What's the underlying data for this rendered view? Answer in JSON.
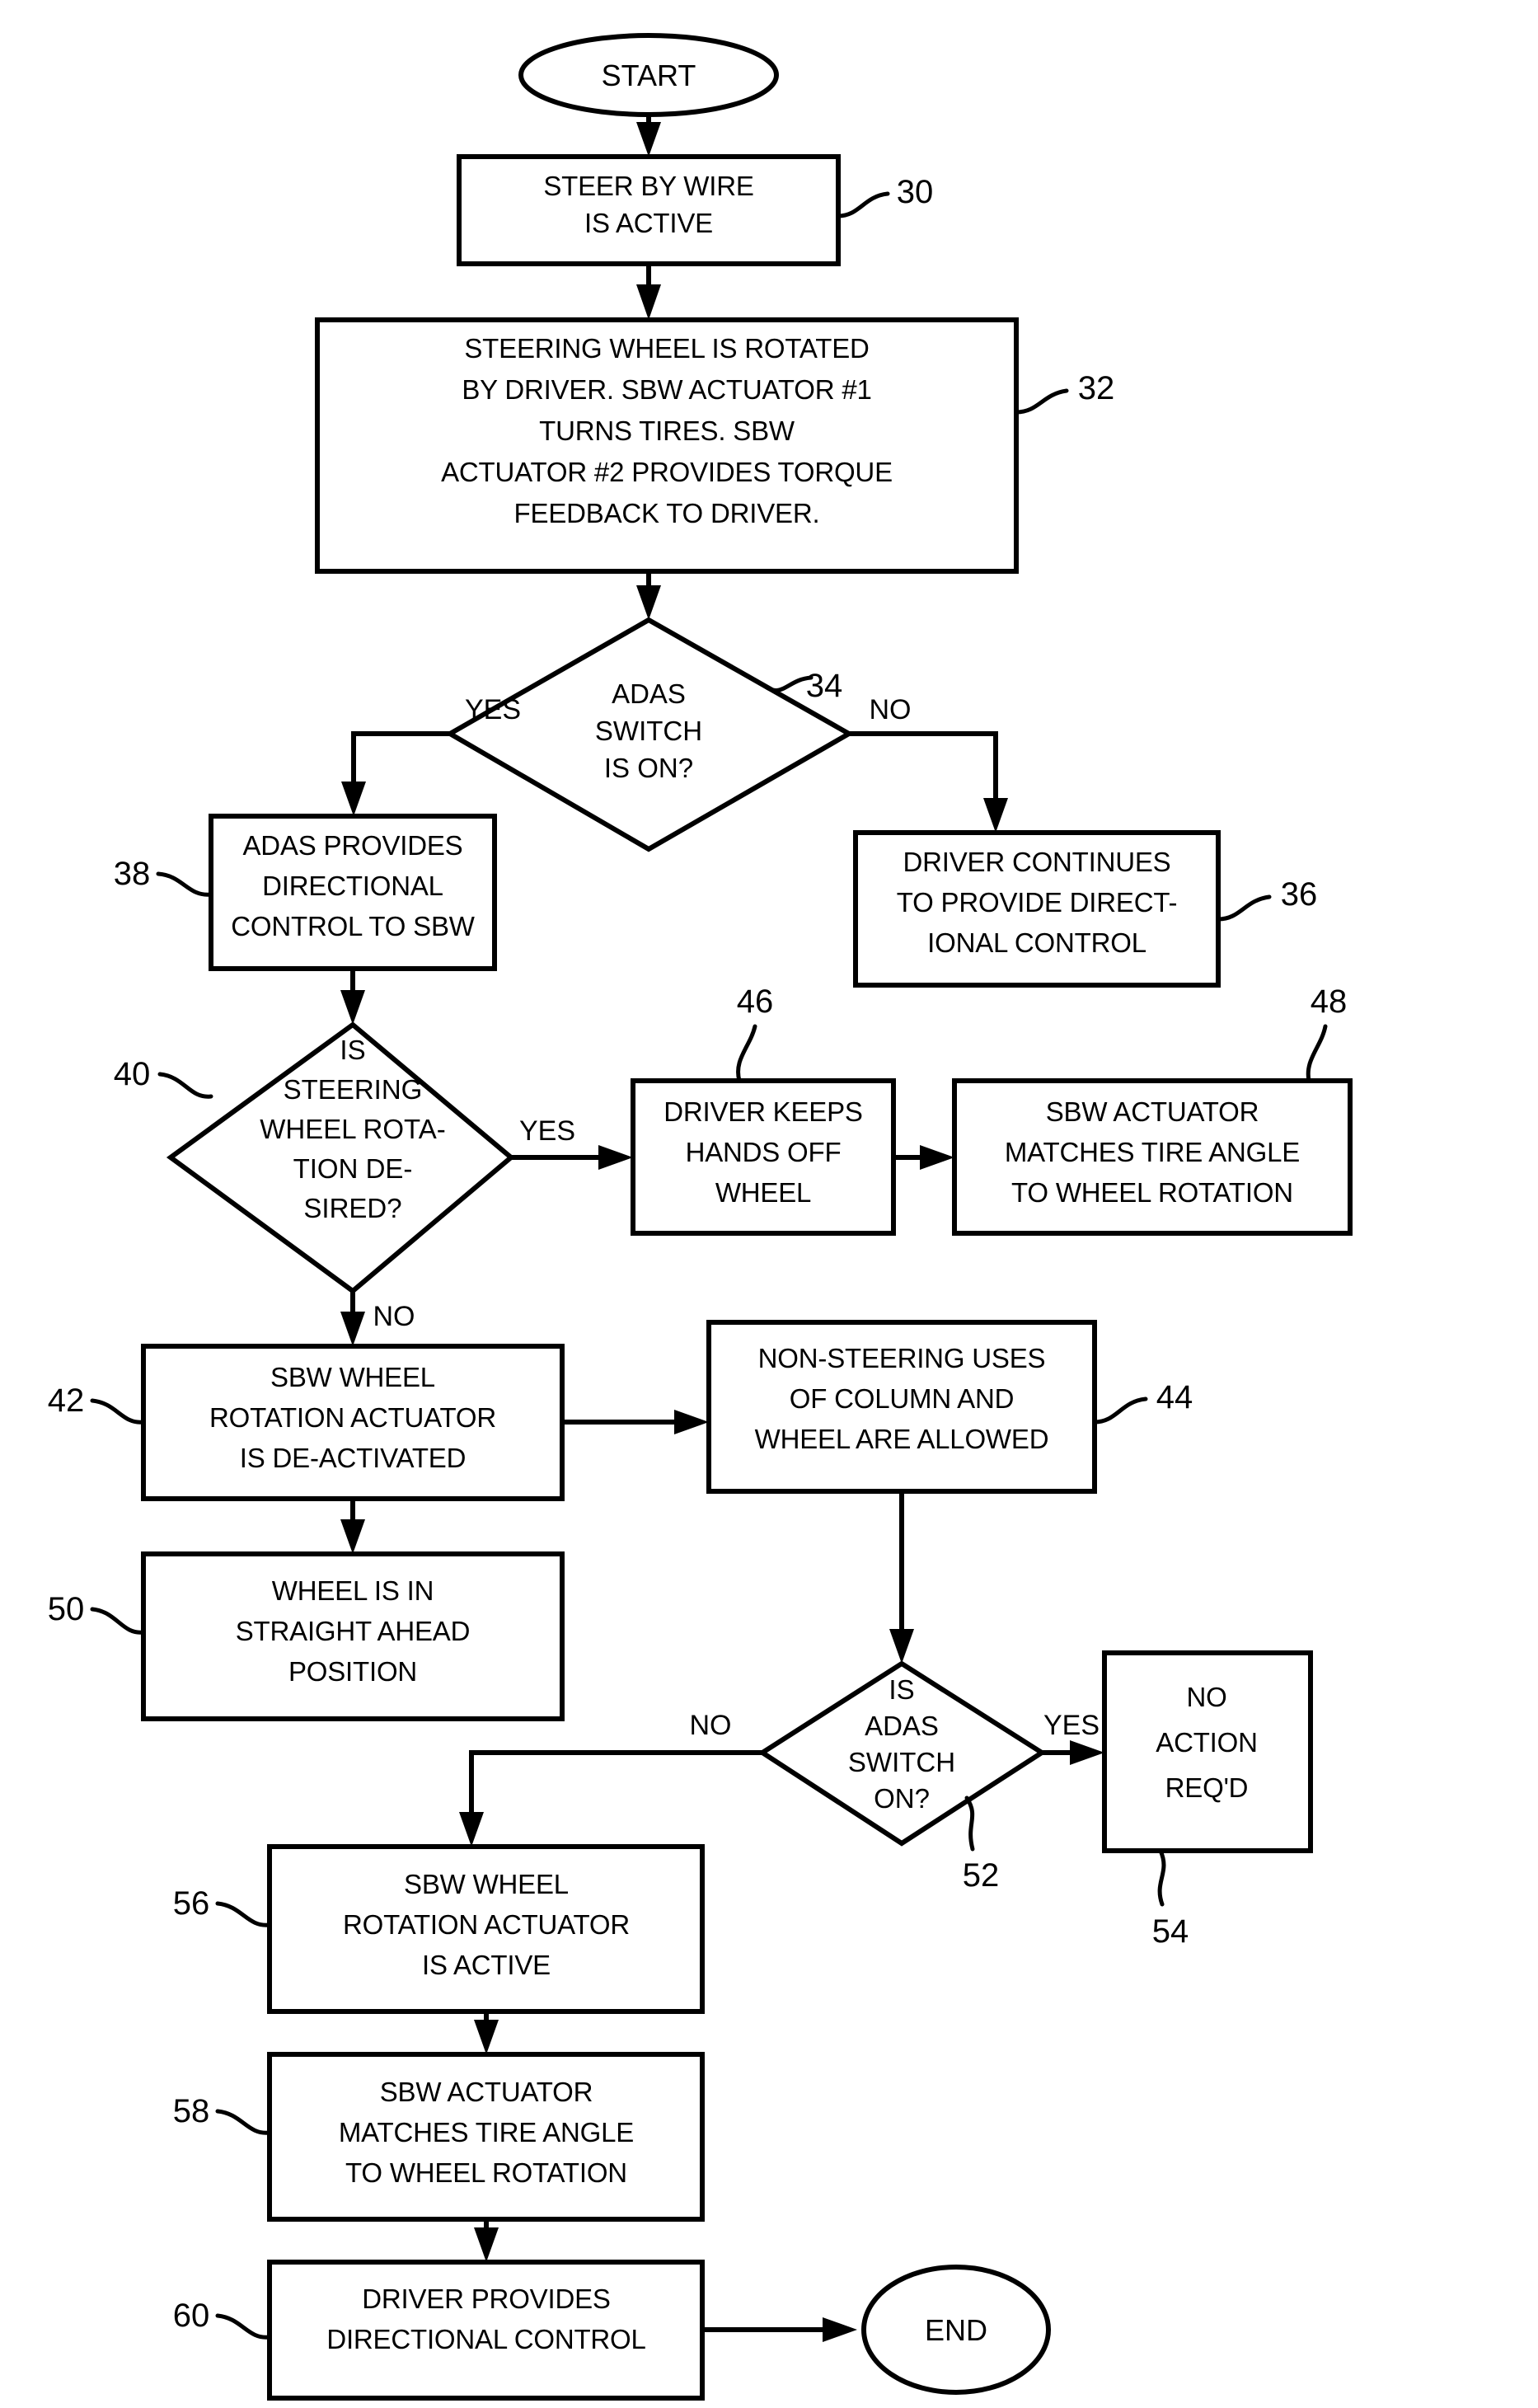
{
  "figure": {
    "type": "patent-flowchart",
    "title": "Steer-by-wire ADAS control flowchart"
  },
  "terminals": {
    "start": "START",
    "end": "END"
  },
  "nodes": [
    {
      "ref": "30",
      "kind": "process",
      "lines": [
        "STEER BY WIRE",
        "IS ACTIVE"
      ]
    },
    {
      "ref": "32",
      "kind": "process",
      "lines": [
        "STEERING WHEEL IS ROTATED",
        "BY DRIVER. SBW ACTUATOR #1",
        "TURNS TIRES. SBW",
        "ACTUATOR #2 PROVIDES TORQUE",
        "FEEDBACK TO DRIVER."
      ]
    },
    {
      "ref": "34",
      "kind": "decision",
      "lines": [
        "ADAS",
        "SWITCH",
        "IS ON?"
      ]
    },
    {
      "ref": "36",
      "kind": "process",
      "lines": [
        "DRIVER CONTINUES",
        "TO PROVIDE DIRECT-",
        "IONAL CONTROL"
      ]
    },
    {
      "ref": "38",
      "kind": "process",
      "lines": [
        "ADAS PROVIDES",
        "DIRECTIONAL",
        "CONTROL TO SBW"
      ]
    },
    {
      "ref": "40",
      "kind": "decision",
      "lines": [
        "IS",
        "STEERING",
        "WHEEL ROTA-",
        "TION DE-",
        "SIRED?"
      ]
    },
    {
      "ref": "42",
      "kind": "process",
      "lines": [
        "SBW WHEEL",
        "ROTATION ACTUATOR",
        "IS DE-ACTIVATED"
      ]
    },
    {
      "ref": "44",
      "kind": "process",
      "lines": [
        "NON-STEERING USES",
        "OF COLUMN AND",
        "WHEEL ARE ALLOWED"
      ]
    },
    {
      "ref": "46",
      "kind": "process",
      "lines": [
        "DRIVER KEEPS",
        "HANDS OFF",
        "WHEEL"
      ]
    },
    {
      "ref": "48",
      "kind": "process",
      "lines": [
        "SBW ACTUATOR",
        "MATCHES TIRE ANGLE",
        "TO WHEEL ROTATION"
      ]
    },
    {
      "ref": "50",
      "kind": "process",
      "lines": [
        "WHEEL IS IN",
        "STRAIGHT AHEAD",
        "POSITION"
      ]
    },
    {
      "ref": "52",
      "kind": "decision",
      "lines": [
        "IS",
        "ADAS",
        "SWITCH",
        "ON?"
      ]
    },
    {
      "ref": "54",
      "kind": "process",
      "lines": [
        "NO",
        "ACTION",
        "REQ'D"
      ]
    },
    {
      "ref": "56",
      "kind": "process",
      "lines": [
        "SBW WHEEL",
        "ROTATION ACTUATOR",
        "IS ACTIVE"
      ]
    },
    {
      "ref": "58",
      "kind": "process",
      "lines": [
        "SBW ACTUATOR",
        "MATCHES TIRE ANGLE",
        "TO WHEEL ROTATION"
      ]
    },
    {
      "ref": "60",
      "kind": "process",
      "lines": [
        "DRIVER PROVIDES",
        "DIRECTIONAL CONTROL"
      ]
    }
  ],
  "edge_labels": {
    "d34_yes": "YES",
    "d34_no": "NO",
    "d40_yes": "YES",
    "d40_no": "NO",
    "d52_yes": "YES",
    "d52_no": "NO"
  },
  "colors": {
    "ink": "#000000",
    "paper": "#ffffff"
  }
}
